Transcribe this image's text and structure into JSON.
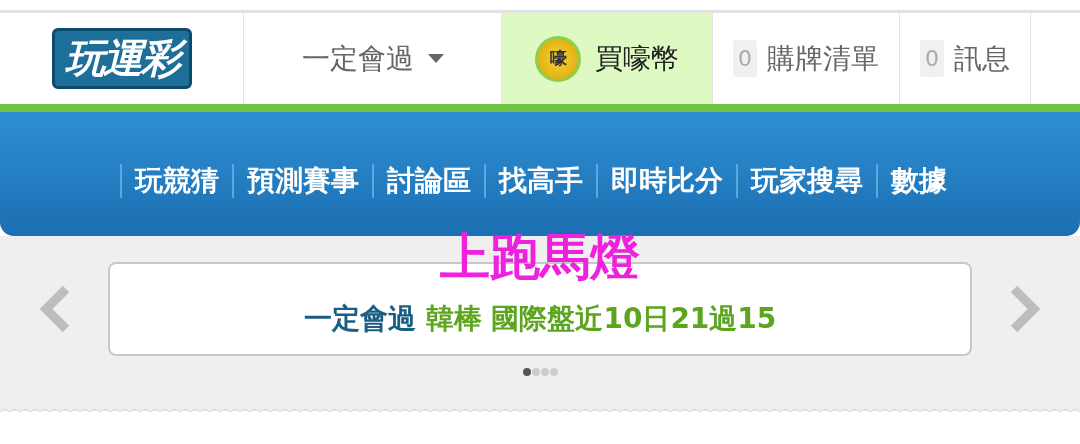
{
  "header": {
    "logo": "玩運彩",
    "user_menu": "一定會過",
    "coin": {
      "label": "買嚎幣",
      "badge": "嚎"
    },
    "counters": [
      {
        "count": "0",
        "label": "購牌清單"
      },
      {
        "count": "0",
        "label": "訊息"
      }
    ]
  },
  "nav": {
    "items": [
      "玩競猜",
      "預測賽事",
      "討論區",
      "找高手",
      "即時比分",
      "玩家搜尋",
      "數據"
    ]
  },
  "annotation": "上跑馬燈",
  "marquee": {
    "author": "一定會過",
    "message": "韓棒 國際盤近10日21過15",
    "dots": [
      {
        "selected": true
      },
      {
        "selected": false
      },
      {
        "selected": false
      },
      {
        "selected": false
      }
    ]
  }
}
